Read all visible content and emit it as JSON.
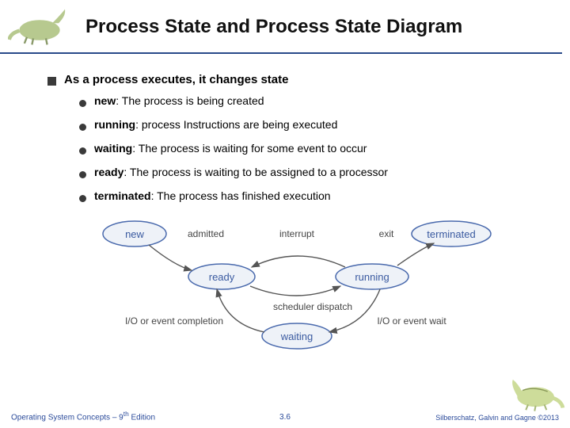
{
  "header": {
    "title": "Process State and Process State Diagram"
  },
  "body": {
    "lead_prefix": "As a process executes, it changes ",
    "lead_keyword": "state",
    "items": [
      {
        "term": "new",
        "sep": ":  ",
        "desc": "The process is being created"
      },
      {
        "term": "running",
        "sep": ": ",
        "desc": "process Instructions are being executed"
      },
      {
        "term": "waiting",
        "sep": ":  ",
        "desc": "The process is waiting for some event to occur"
      },
      {
        "term": "ready",
        "sep": ":  ",
        "desc": "The process is waiting to be assigned to a processor"
      },
      {
        "term": "terminated",
        "sep": ":  ",
        "desc": "The process has finished execution"
      }
    ]
  },
  "diagram": {
    "nodes": {
      "new": "new",
      "ready": "ready",
      "running": "running",
      "waiting": "waiting",
      "terminated": "terminated"
    },
    "edges": {
      "admitted": "admitted",
      "interrupt": "interrupt",
      "exit": "exit",
      "dispatch": "scheduler dispatch",
      "iowait": "I/O or event wait",
      "iocomp": "I/O or event completion"
    }
  },
  "footer": {
    "left_prefix": "Operating System Concepts – 9",
    "left_sup": "th",
    "left_suffix": " Edition",
    "center": "3.6",
    "right": "Silberschatz, Galvin and Gagne ©2013"
  }
}
